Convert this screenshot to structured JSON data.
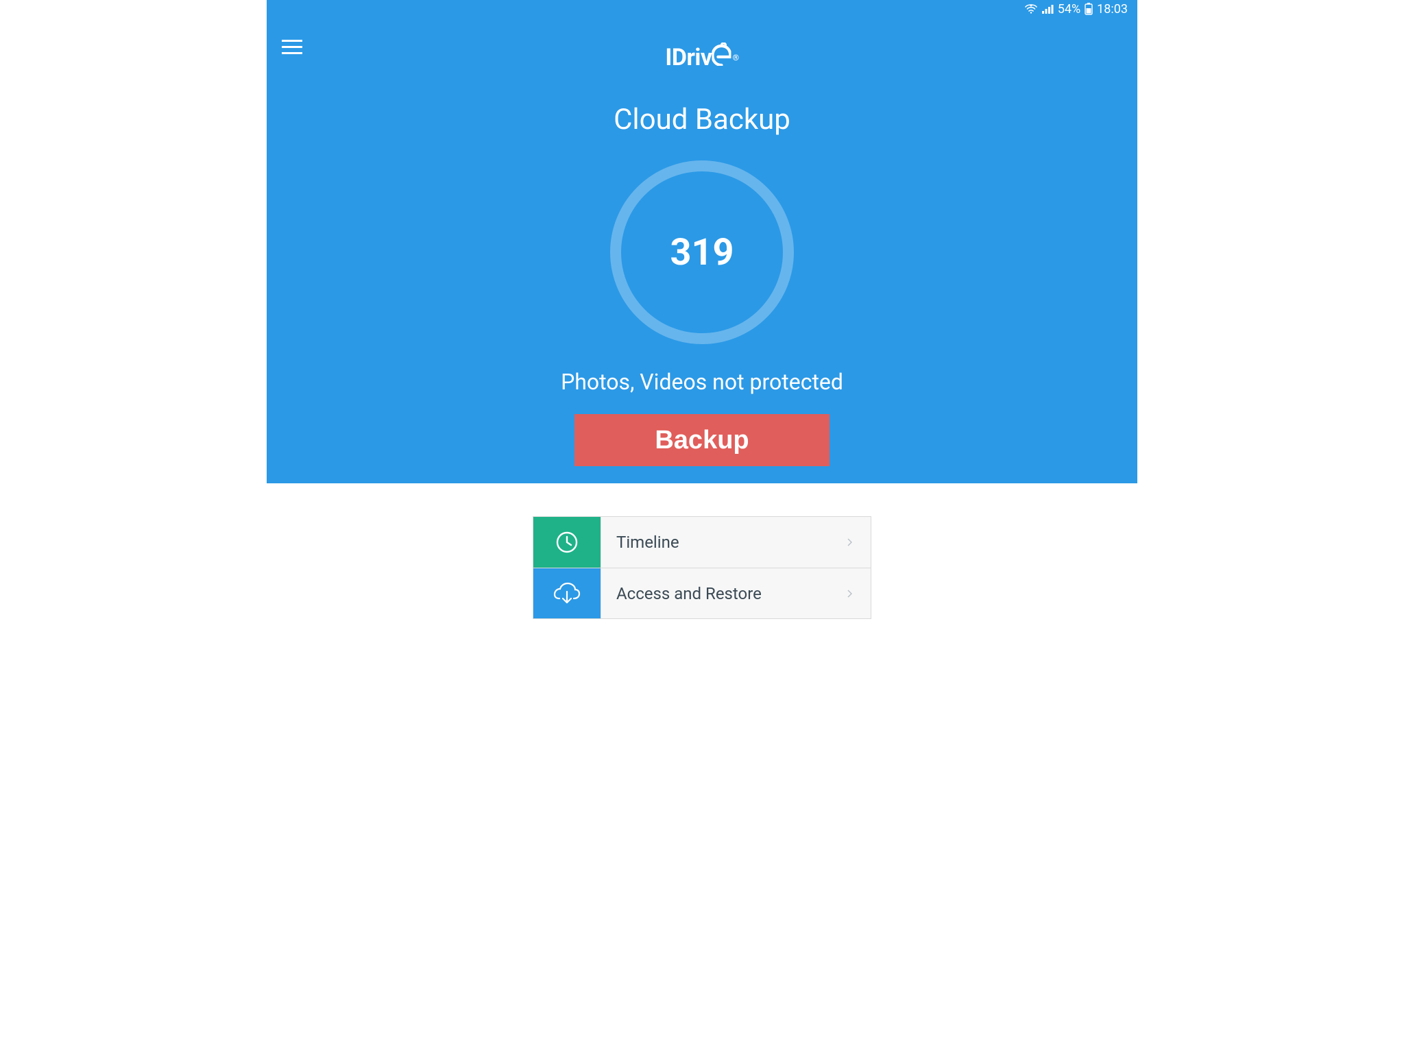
{
  "colors": {
    "primary": "#2b99e6",
    "danger": "#e05e5b",
    "green": "#1fb289"
  },
  "status_bar": {
    "battery_percent": "54%",
    "time": "18:03"
  },
  "header": {
    "logo_text": "IDrive",
    "reg_mark": "®"
  },
  "main": {
    "title": "Cloud Backup",
    "count": "319",
    "status_text": "Photos, Videos not protected",
    "backup_button": "Backup"
  },
  "menu": {
    "items": [
      {
        "icon": "clock-icon",
        "label": "Timeline"
      },
      {
        "icon": "cloud-download-icon",
        "label": "Access and Restore"
      }
    ]
  }
}
